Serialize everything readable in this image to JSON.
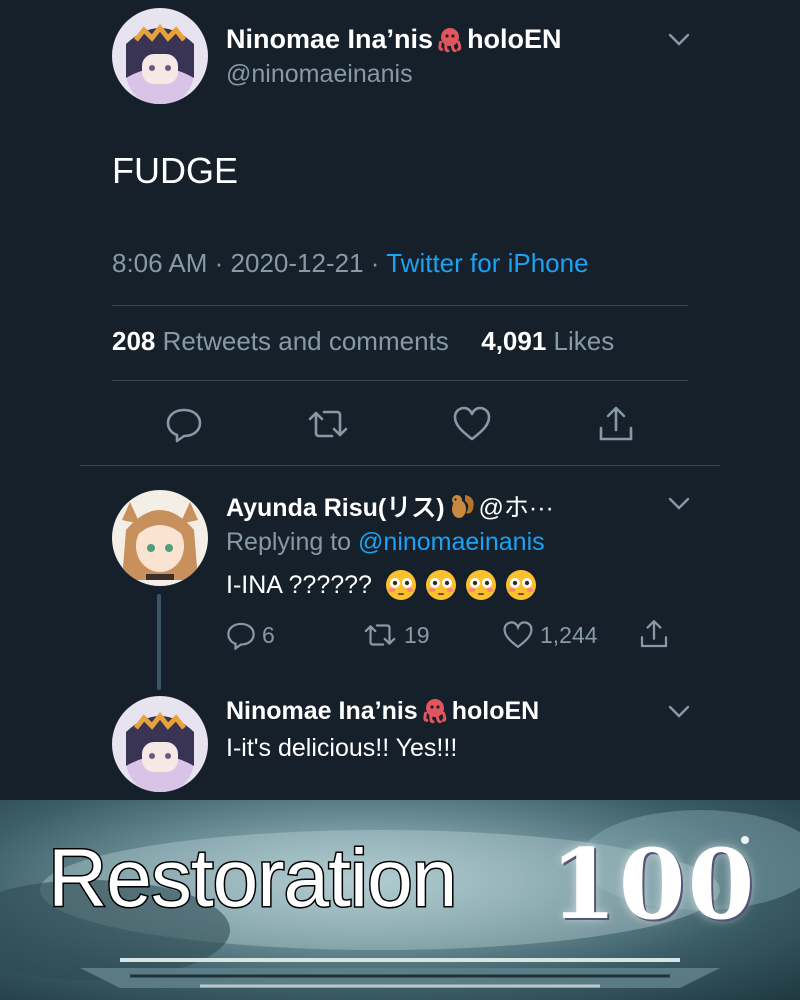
{
  "main_tweet": {
    "display_name_part1": "Ninomae Ina’nis",
    "display_name_part2": "holoEN",
    "handle": "@ninomaeinanis",
    "text": "FUDGE",
    "time": "8:06 AM",
    "date": "2020-12-21",
    "separator": "·",
    "source": "Twitter for iPhone",
    "retweets_count": "208",
    "retweets_label": "Retweets and comments",
    "likes_count": "4,091",
    "likes_label": "Likes"
  },
  "reply_1": {
    "display_name": "Ayunda Risu(リス)",
    "handle_truncated": "@ホ···",
    "replying_prefix": "Replying to",
    "replying_handle": "@ninomaeinanis",
    "text": "I-INA ??????",
    "reply_count": "6",
    "retweet_count": "19",
    "like_count": "1,244"
  },
  "reply_2": {
    "display_name_part1": "Ninomae Ina’nis",
    "display_name_part2": "holoEN",
    "text": "I-it's delicious!! Yes!!!"
  },
  "banner": {
    "skill_name": "Restoration",
    "skill_level": "100"
  },
  "icons": {
    "octopus": "octopus-emoji",
    "squirrel": "squirrel-emoji",
    "flushed": "flushed-face-emoji",
    "reply": "reply-icon",
    "retweet": "retweet-icon",
    "like": "heart-icon",
    "share": "share-icon",
    "menu": "chevron-down-icon"
  },
  "colors": {
    "background": "#15202b",
    "secondary_text": "#8899a6",
    "link": "#1da1f2",
    "divider": "#38444d"
  }
}
